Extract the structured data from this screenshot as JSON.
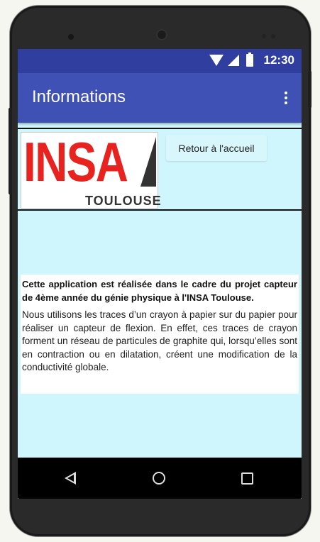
{
  "status_bar": {
    "time": "12:30",
    "icons": [
      "wifi-icon",
      "signal-icon",
      "battery-icon"
    ]
  },
  "app_bar": {
    "title": "Informations",
    "menu_icon": "overflow-menu-icon"
  },
  "logo": {
    "main_text": "INSA",
    "sub_text": "TOULOUSE"
  },
  "buttons": {
    "back_home": "Retour à l'accueil"
  },
  "content": {
    "bold_text": "Cette application est réalisée dans le cadre du projet capteur de 4ème année du génie physique à l'INSA Toulouse.",
    "body_text": "Nous utilisons les traces d’un crayon à papier sur du papier pour réaliser un capteur de flexion. En effet, ces traces de crayon forment un réseau de particules de graphite qui, lorsqu’elles sont en contraction ou en dilatation, créent une modification de la conductivité globale."
  },
  "nav_bar": {
    "icons": [
      "back-nav-icon",
      "home-nav-icon",
      "recents-nav-icon"
    ]
  },
  "colors": {
    "status_bar": "#303f9f",
    "app_bar": "#3f51b5",
    "screen_background": "#cef6fc",
    "logo_red": "#e8231f"
  }
}
